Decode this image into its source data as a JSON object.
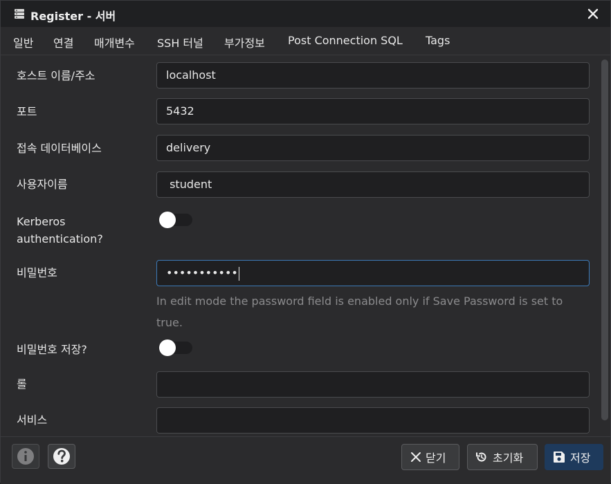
{
  "window": {
    "title": "Register - 서버"
  },
  "tabs": [
    {
      "label": "일반"
    },
    {
      "label": "연결"
    },
    {
      "label": "매개변수"
    },
    {
      "label": "SSH 터널"
    },
    {
      "label": "부가정보"
    },
    {
      "label": "Post Connection SQL"
    },
    {
      "label": "Tags"
    }
  ],
  "active_tab": "연결",
  "form": {
    "host_label": "호스트 이름/주소",
    "host_value": "localhost",
    "port_label": "포트",
    "port_value": "5432",
    "db_label": "접속 데이터베이스",
    "db_value": "delivery",
    "user_label": "사용자이름",
    "user_value": " student",
    "kerberos_label_1": "Kerberos",
    "kerberos_label_2": "authentication?",
    "kerberos_enabled": false,
    "password_label": "비밀번호",
    "password_value": "•••••••••••",
    "password_help": "In edit mode the password field is enabled only if Save Password is set to true.",
    "save_password_label": "비밀번호 저장?",
    "save_password_enabled": false,
    "role_label": "롤",
    "role_value": "",
    "service_label": "서비스",
    "service_value": ""
  },
  "footer": {
    "close_label": "닫기",
    "reset_label": "초기화",
    "save_label": "저장"
  },
  "colors": {
    "background": "#2b2b2d",
    "input_bg": "#1f1f21",
    "focus_border": "#3d7ab8",
    "primary_button": "#1e3a5c",
    "help_text": "#8b8b8d"
  }
}
